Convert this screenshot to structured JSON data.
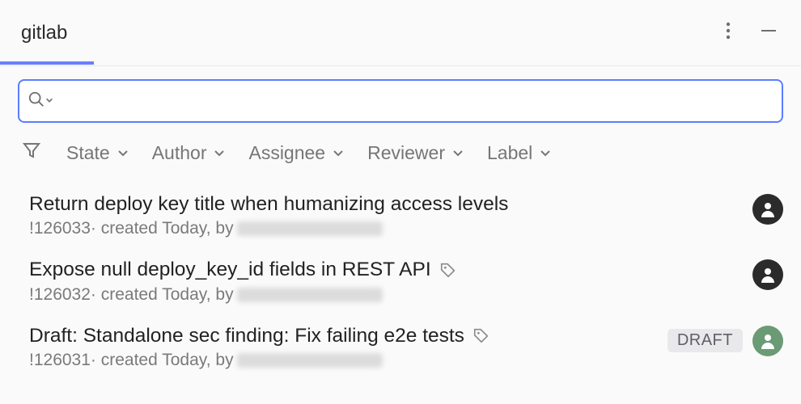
{
  "header": {
    "tab_label": "gitlab"
  },
  "search": {
    "value": "",
    "placeholder": ""
  },
  "filters": {
    "state": "State",
    "author": "Author",
    "assignee": "Assignee",
    "reviewer": "Reviewer",
    "label": "Label"
  },
  "merge_requests": [
    {
      "title": "Return deploy key title when humanizing access levels",
      "ref": "!126033",
      "meta": " · created Today, by ",
      "has_labels": false,
      "badge": null,
      "avatar_style": "dark"
    },
    {
      "title": "Expose null deploy_key_id fields in REST API",
      "ref": "!126032",
      "meta": " · created Today, by ",
      "has_labels": true,
      "badge": null,
      "avatar_style": "dark"
    },
    {
      "title": "Draft: Standalone sec finding: Fix failing e2e tests",
      "ref": "!126031",
      "meta": " · created Today, by ",
      "has_labels": true,
      "badge": "DRAFT",
      "avatar_style": "green"
    }
  ]
}
